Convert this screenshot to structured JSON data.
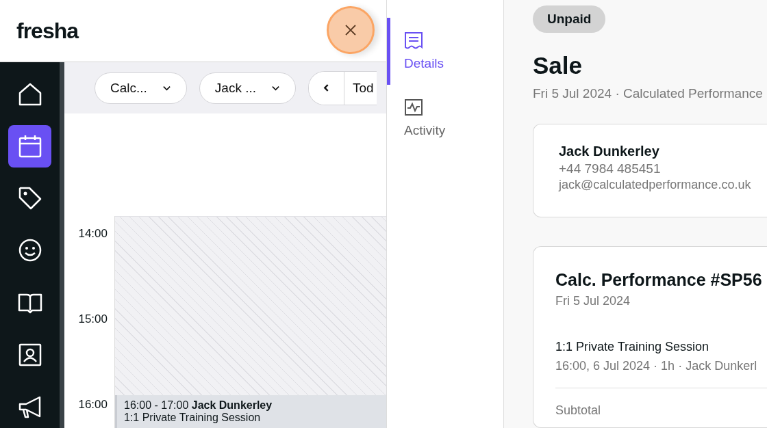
{
  "header": {
    "logo": "fresha"
  },
  "nav": [
    {
      "kind": "home",
      "selected": false
    },
    {
      "kind": "calendar",
      "selected": true
    },
    {
      "kind": "tag",
      "selected": false
    },
    {
      "kind": "smiley",
      "selected": false
    },
    {
      "kind": "book",
      "selected": false
    },
    {
      "kind": "contact",
      "selected": false
    },
    {
      "kind": "megaphone",
      "selected": false
    }
  ],
  "toolbar": {
    "filters": [
      "Calc...",
      "Jack ..."
    ],
    "today": "Tod"
  },
  "calendar": {
    "hours": [
      "14:00",
      "15:00",
      "16:00"
    ],
    "event": {
      "time": "16:00 - 17:00",
      "client": "Jack Dunkerley",
      "service": "1:1 Private Training Session"
    }
  },
  "panel_tabs": [
    {
      "label": "Details",
      "kind": "receipt",
      "selected": true
    },
    {
      "label": "Activity",
      "kind": "activity",
      "selected": false
    }
  ],
  "sale": {
    "status": "Unpaid",
    "title": "Sale",
    "subtitle": "Fri 5 Jul 2024 · Calculated Performance",
    "client": {
      "name": "Jack Dunkerley",
      "phone": "+44 7984 485451",
      "email": "jack@calculatedperformance.co.uk"
    },
    "invoice": {
      "title": "Calc. Performance #SP56",
      "date": "Fri 5 Jul 2024",
      "item": {
        "name": "1:1 Private Training Session",
        "details": "16:00, 6 Jul 2024 · 1h · Jack Dunkerl"
      },
      "subtotal_label": "Subtotal"
    }
  }
}
